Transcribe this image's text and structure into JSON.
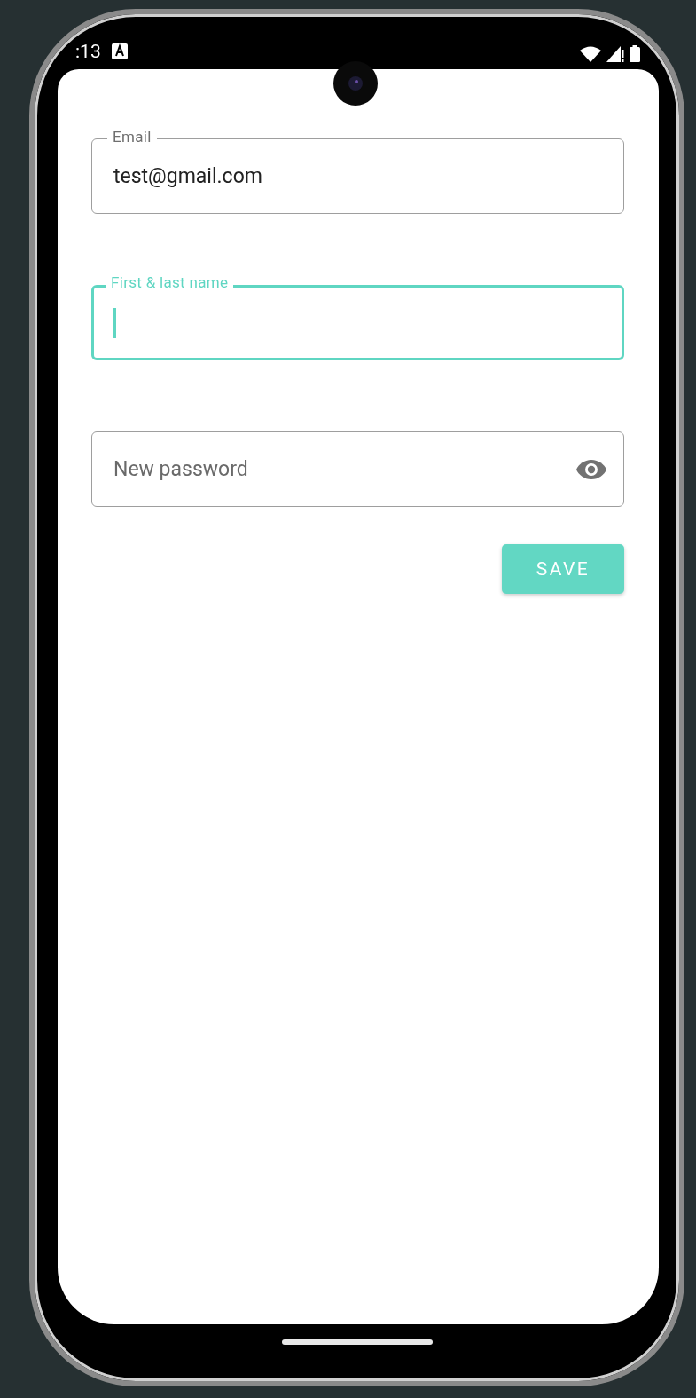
{
  "status_bar": {
    "time": ":13"
  },
  "fields": [
    {
      "label": "Email",
      "value": "test@gmail.com",
      "focused": false
    },
    {
      "label": "First & last name",
      "focused": true
    },
    {
      "placeholder": "New password",
      "focused": false,
      "kind": "password"
    }
  ],
  "save_button": {
    "label": "SAVE"
  }
}
